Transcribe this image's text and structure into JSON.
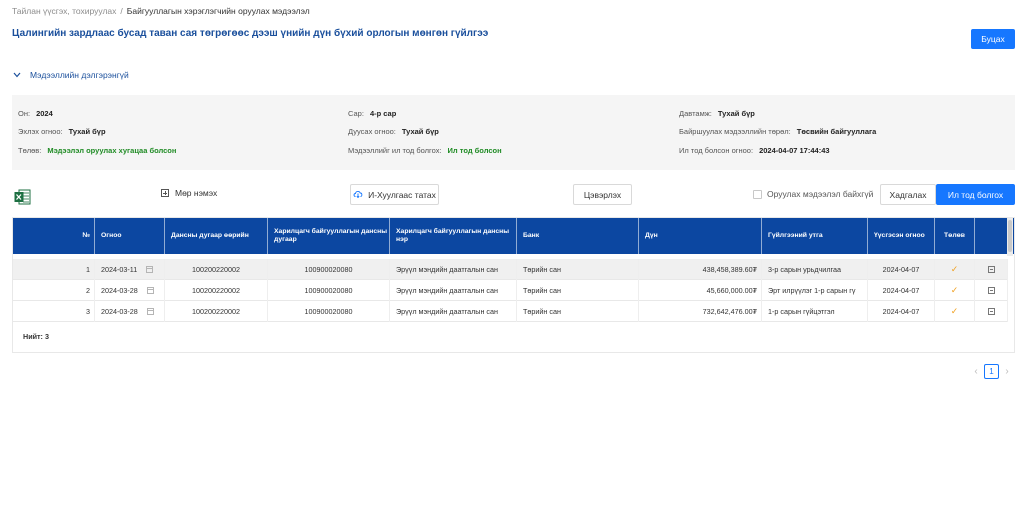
{
  "breadcrumb": {
    "parent": "Тайлан үүсгэх, тохируулах",
    "separator": "/",
    "current": "Байгууллагын хэрэглэгчийн оруулах мэдээлэл"
  },
  "page": {
    "title": "Цалингийн зардлаас бусад таван сая төгрөгөөс дээш үнийн дүн бүхий орлогын мөнгөн гүйлгээ",
    "back_label": "Буцах"
  },
  "details": {
    "section_label": "Мэдээллийн дэлгэрэнгүй",
    "year_label": "Он:",
    "year_value": "2024",
    "month_label": "Сар:",
    "month_value": "4-р сар",
    "frequency_label": "Давтамж:",
    "frequency_value": "Тухай бүр",
    "start_label": "Эхлэх огноо:",
    "start_value": "Тухай бүр",
    "end_label": "Дуусах огноо:",
    "end_value": "Тухай бүр",
    "org_type_label": "Байршуулах мэдээллийн төрөл:",
    "org_type_value": "Төсвийн байгууллага",
    "status_label": "Төлөв:",
    "status_value": "Мэдээлэл оруулах хугацаа болсон",
    "submit_label": "Мэдээллийг ил тод болгох:",
    "submit_value": "Ил тод болсон",
    "published_label": "Ил тод болсон огноо:",
    "published_value": "2024-04-07 17:44:43"
  },
  "toolbar": {
    "add_row": "Мөр нэмэх",
    "fetch": "И-Хуулгаас татах",
    "clear": "Цэвэрлэх",
    "checkbox_label": "Оруулах мэдээлэл байхгүй",
    "save": "Хадгалах",
    "publish": "Ил тод болгох"
  },
  "table": {
    "headers": {
      "no": "№",
      "date": "Огноо",
      "own_account": "Дансны дугаар өөрийн",
      "partner_account": "Харилцагч байгууллагын дансны дугаар",
      "partner_name": "Харилцагч байгууллагын дансны нэр",
      "bank": "Банк",
      "amount": "Дүн",
      "purpose": "Гүйлгээний утга",
      "created": "Үүсгэсэн огноо",
      "status": "Төлөв"
    },
    "rows": [
      {
        "no": "1",
        "date": "2024-03-11",
        "own_account": "100200220002",
        "partner_account": "100900020080",
        "partner_name": "Эрүүл мэндийн даатгалын сан",
        "bank": "Төрийн сан",
        "amount": "438,458,389.60₮",
        "purpose": "3-р сарын урьдчилгаа",
        "created": "2024-04-07"
      },
      {
        "no": "2",
        "date": "2024-03-28",
        "own_account": "100200220002",
        "partner_account": "100900020080",
        "partner_name": "Эрүүл мэндийн даатгалын сан",
        "bank": "Төрийн сан",
        "amount": "45,660,000.00₮",
        "purpose": "Эрт илрүүлэг 1-р сарын гү",
        "created": "2024-04-07"
      },
      {
        "no": "3",
        "date": "2024-03-28",
        "own_account": "100200220002",
        "partner_account": "100900020080",
        "partner_name": "Эрүүл мэндийн даатгалын сан",
        "bank": "Төрийн сан",
        "amount": "732,642,476.00₮",
        "purpose": "1-р сарын гүйцэтгэл",
        "created": "2024-04-07"
      }
    ],
    "total": "Нийт: 3"
  },
  "pagination": {
    "current_page": "1",
    "prev": "‹",
    "next": "›"
  },
  "colors": {
    "primary": "#1677ff",
    "header_bg": "#0c47a1",
    "title": "#1a4f9c",
    "success": "#1f8b24",
    "check": "#f0a020"
  }
}
